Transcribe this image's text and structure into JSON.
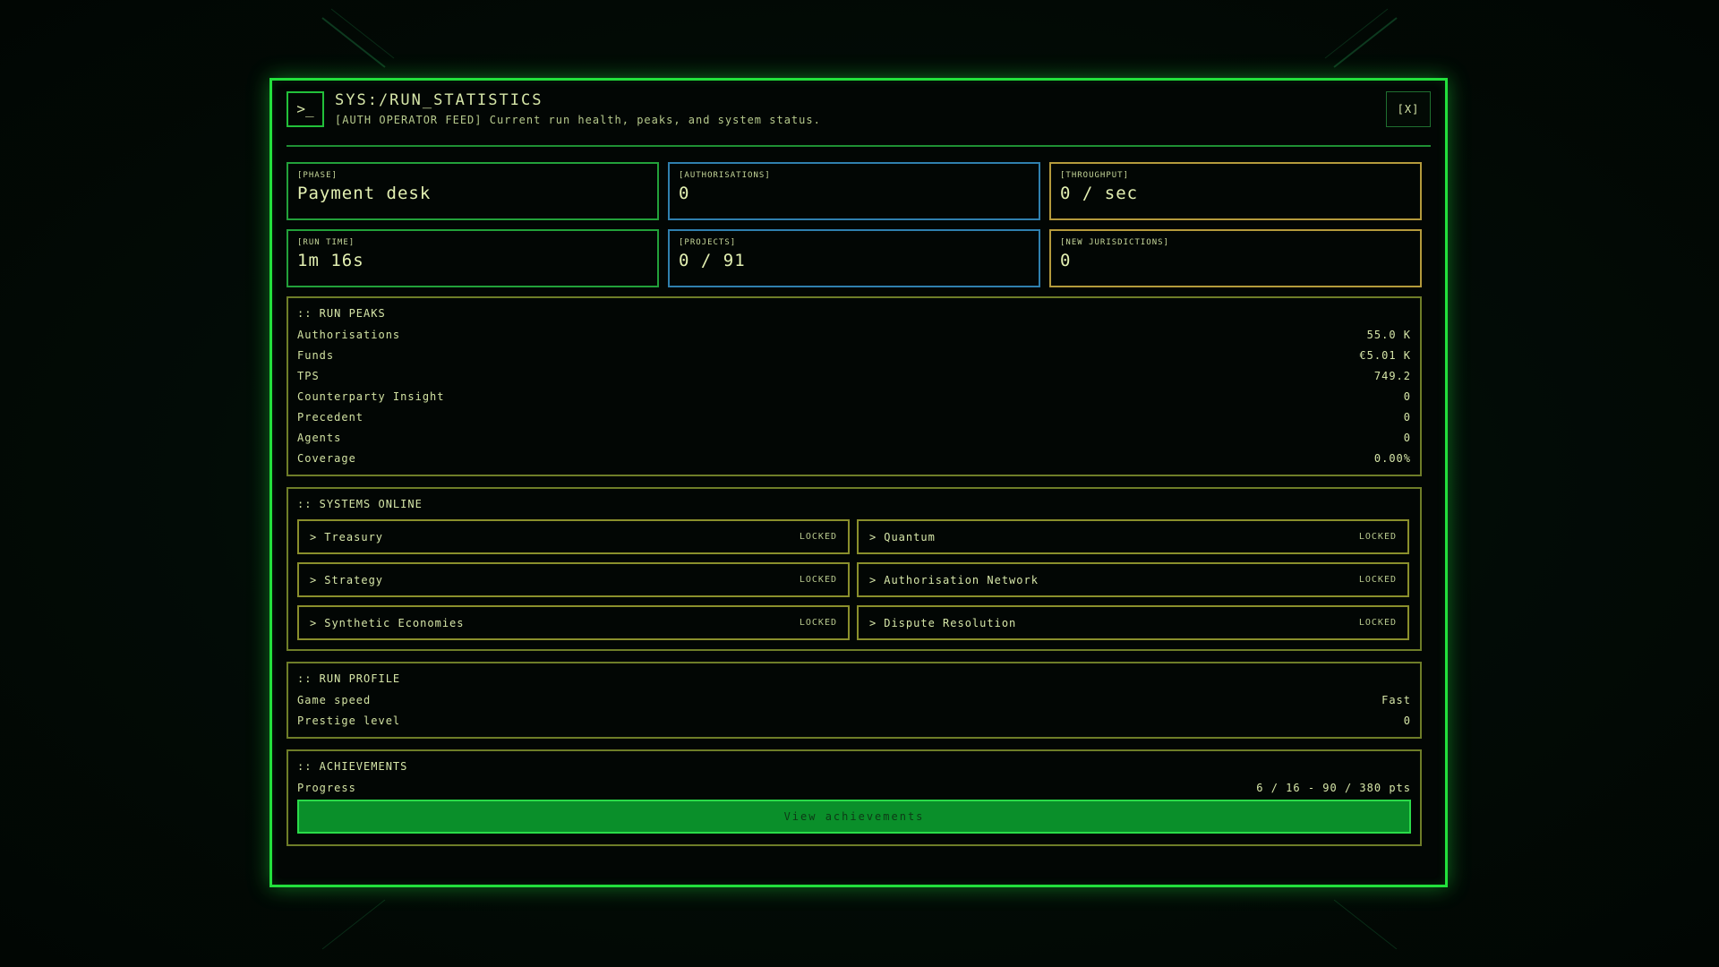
{
  "header": {
    "prompt_symbol": ">_",
    "title": "SYS:/RUN_STATISTICS",
    "subtitle": "[AUTH OPERATOR FEED] Current run health, peaks, and system status.",
    "close_label": "[X]"
  },
  "stats": [
    {
      "label": "[PHASE]",
      "value": "Payment desk"
    },
    {
      "label": "[AUTHORISATIONS]",
      "value": "0"
    },
    {
      "label": "[THROUGHPUT]",
      "value": "0 / sec"
    },
    {
      "label": "[RUN TIME]",
      "value": "1m 16s"
    },
    {
      "label": "[PROJECTS]",
      "value": "0 / 91"
    },
    {
      "label": "[NEW JURISDICTIONS]",
      "value": "0"
    }
  ],
  "run_peaks": {
    "title": ":: RUN PEAKS",
    "rows": [
      {
        "label": "Authorisations",
        "value": "55.0 K"
      },
      {
        "label": "Funds",
        "value": "€5.01 K"
      },
      {
        "label": "TPS",
        "value": "749.2"
      },
      {
        "label": "Counterparty Insight",
        "value": "0"
      },
      {
        "label": "Precedent",
        "value": "0"
      },
      {
        "label": "Agents",
        "value": "0"
      },
      {
        "label": "Coverage",
        "value": "0.00%"
      }
    ]
  },
  "systems_online": {
    "title": ":: SYSTEMS ONLINE",
    "items": [
      {
        "name": "Treasury",
        "status": "LOCKED"
      },
      {
        "name": "Quantum",
        "status": "LOCKED"
      },
      {
        "name": "Strategy",
        "status": "LOCKED"
      },
      {
        "name": "Authorisation Network",
        "status": "LOCKED"
      },
      {
        "name": "Synthetic Economies",
        "status": "LOCKED"
      },
      {
        "name": "Dispute Resolution",
        "status": "LOCKED"
      }
    ]
  },
  "run_profile": {
    "title": ":: RUN PROFILE",
    "rows": [
      {
        "label": "Game speed",
        "value": "Fast"
      },
      {
        "label": "Prestige level",
        "value": "0"
      }
    ]
  },
  "achievements": {
    "title": ":: ACHIEVEMENTS",
    "progress_label": "Progress",
    "progress_value": "6 / 16 - 90 / 380 pts",
    "button_label": "View achievements"
  },
  "colors": {
    "accent_green": "#22e03c",
    "blue_border": "#2f7fae",
    "gold_border": "#b49a3c",
    "button_green": "#0a8f2a"
  }
}
